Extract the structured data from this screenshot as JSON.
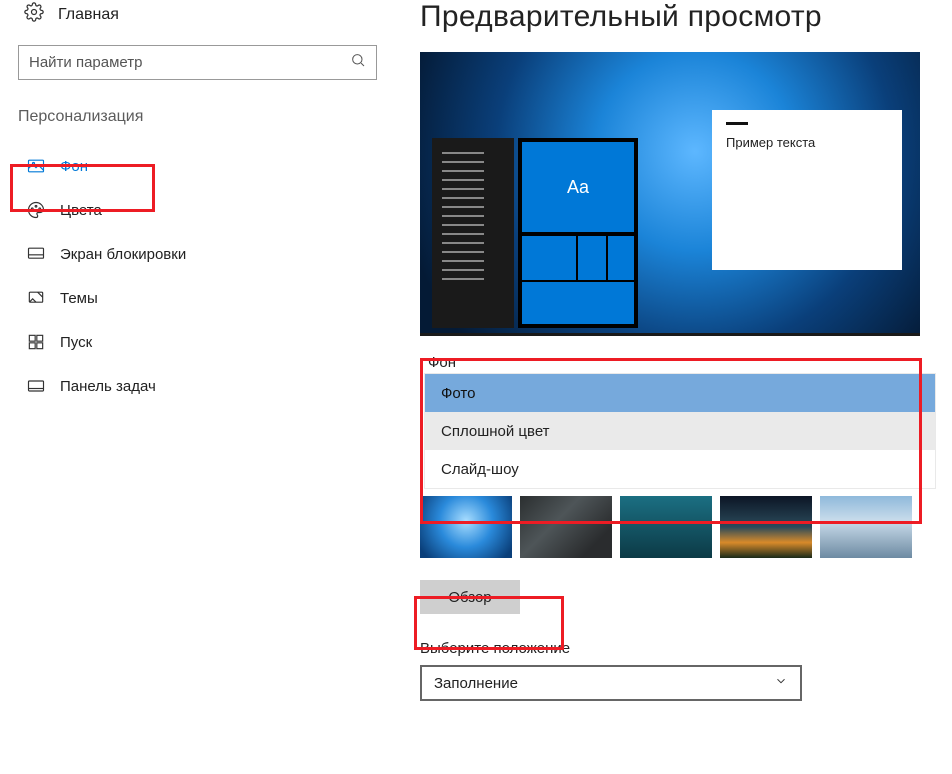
{
  "sidebar": {
    "home_label": "Главная",
    "search_placeholder": "Найти параметр",
    "section_title": "Персонализация",
    "items": [
      {
        "label": "Фон"
      },
      {
        "label": "Цвета"
      },
      {
        "label": "Экран блокировки"
      },
      {
        "label": "Темы"
      },
      {
        "label": "Пуск"
      },
      {
        "label": "Панель задач"
      }
    ]
  },
  "main": {
    "heading": "Предварительный просмотр",
    "preview": {
      "tile_aa": "Aa",
      "sample_text": "Пример текста"
    },
    "background_section": {
      "label": "Фон",
      "options": [
        {
          "label": "Фото"
        },
        {
          "label": "Сплошной цвет"
        },
        {
          "label": "Слайд-шоу"
        }
      ]
    },
    "browse_button": "Обзор",
    "position_section": {
      "label": "Выберите положение",
      "selected": "Заполнение"
    }
  },
  "highlights": {
    "accent_color": "#ED1C24"
  }
}
